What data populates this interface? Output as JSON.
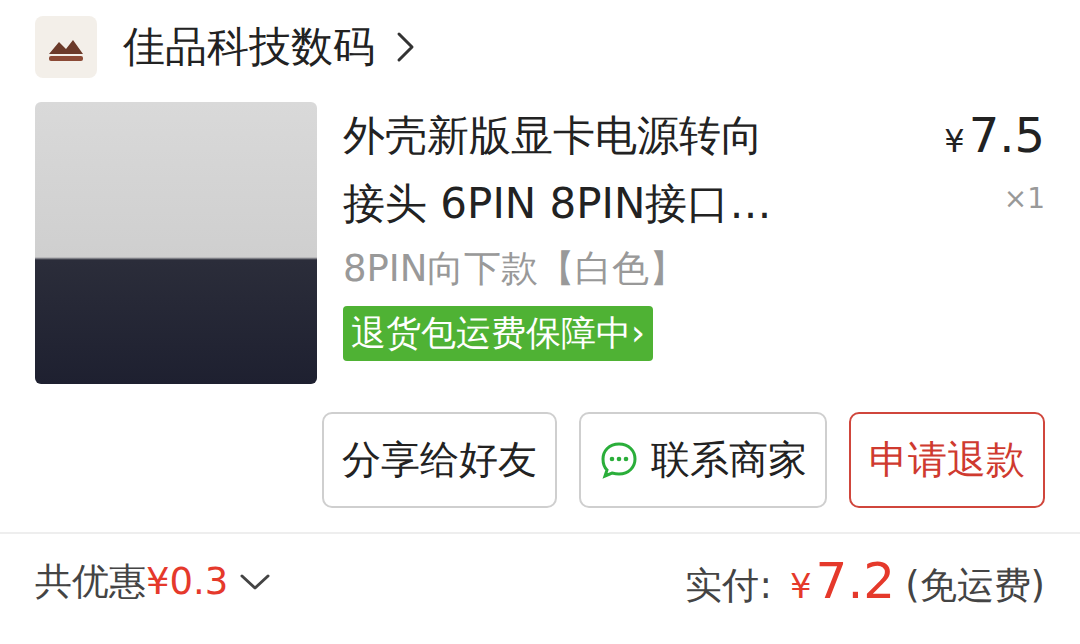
{
  "shop": {
    "name": "佳品科技数码"
  },
  "product": {
    "title_lines": [
      "外壳新版显卡电源转向",
      "接头 6PIN 8PIN接口…"
    ],
    "currency": "¥",
    "price": "7.5",
    "quantity": "×1",
    "variant": "8PIN向下款【白色】",
    "badge": "退货包运费保障中›"
  },
  "buttons": [
    {
      "label": "分享给好友",
      "kind": "plain"
    },
    {
      "label": "联系商家",
      "kind": "chat"
    },
    {
      "label": "申请退款",
      "kind": "danger"
    }
  ],
  "summary": {
    "discount_label": "共优惠",
    "discount_currency": "¥",
    "discount": "0.3",
    "paid_label": "实付:",
    "paid_currency": "¥",
    "paid": "7.2",
    "shipping": "(免运费)"
  }
}
